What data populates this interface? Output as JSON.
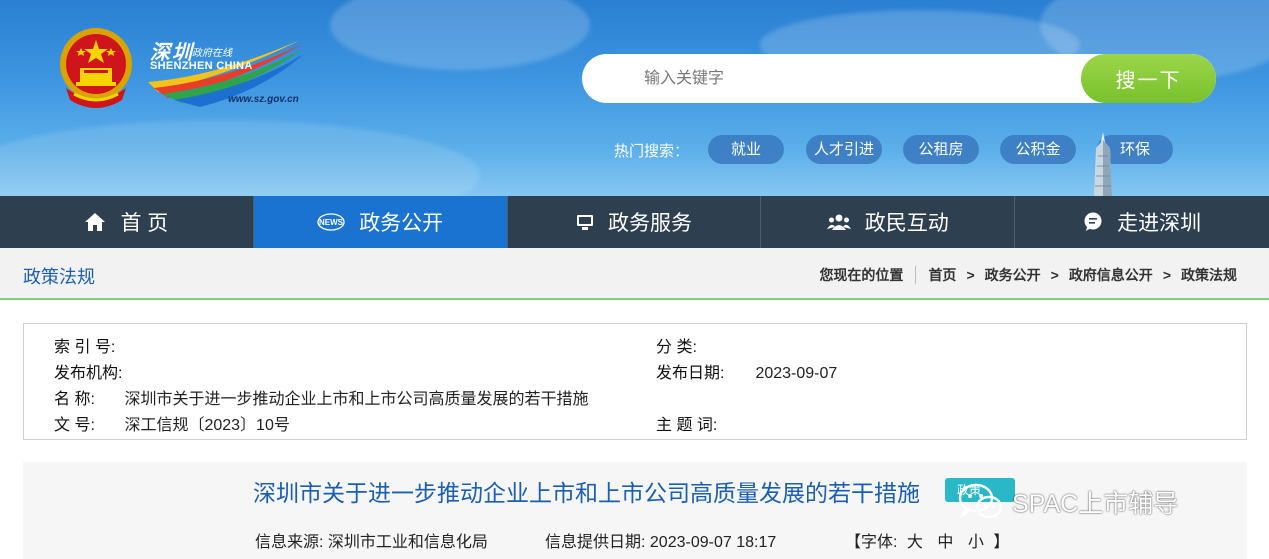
{
  "site": {
    "logo_cn": "深圳",
    "logo_cn_small": "政府在线",
    "logo_en": "SHENZHEN CHINA",
    "logo_url": "www.sz.gov.cn"
  },
  "search": {
    "placeholder": "输入关键字",
    "button_label": "搜一下"
  },
  "hot_search": {
    "label": "热门搜索：",
    "tags": [
      "就业",
      "人才引进",
      "公租房",
      "公积金",
      "环保"
    ]
  },
  "nav": {
    "items": [
      {
        "label": "首 页",
        "icon": "home-icon"
      },
      {
        "label": "政务公开",
        "icon": "news-icon"
      },
      {
        "label": "政务服务",
        "icon": "monitor-icon"
      },
      {
        "label": "政民互动",
        "icon": "people-icon"
      },
      {
        "label": "走进深圳",
        "icon": "chat-icon"
      }
    ],
    "active_index": 1
  },
  "breadcrumb": {
    "section_title": "政策法规",
    "location_label": "您现在的位置",
    "items": [
      "首页",
      "政务公开",
      "政府信息公开",
      "政策法规"
    ],
    "separator": ">"
  },
  "info": {
    "index_no_label": "索 引 号:",
    "index_no_value": "",
    "category_label": "分 类:",
    "category_value": "",
    "issuer_label": "发布机构:",
    "issuer_value": "",
    "publish_date_label": "发布日期:",
    "publish_date_value": "2023-09-07",
    "name_label": "名 称:",
    "name_value": "深圳市关于进一步推动企业上市和上市公司高质量发展的若干措施",
    "doc_no_label": "文 号:",
    "doc_no_value": "深工信规〔2023〕10号",
    "subject_label": "主 题 词:",
    "subject_value": ""
  },
  "article": {
    "title": "深圳市关于进一步推动企业上市和上市公司高质量发展的若干措施",
    "tag": "政策",
    "source_label": "信息来源:",
    "source_value": "深圳市工业和信息化局",
    "provided_date_label": "信息提供日期:",
    "provided_date_value": "2023-09-07 18:17",
    "font_label_open": "【字体:",
    "font_large": "大",
    "font_medium": "中",
    "font_small": "小",
    "font_label_close": "】"
  },
  "watermark": {
    "text": "SPAC上市辅导"
  },
  "colors": {
    "nav_bg": "#2e3f50",
    "nav_active": "#1a73d1",
    "search_button": "#86c937",
    "link_blue": "#1a5fb4",
    "crumb_underline": "#7fcf84"
  }
}
